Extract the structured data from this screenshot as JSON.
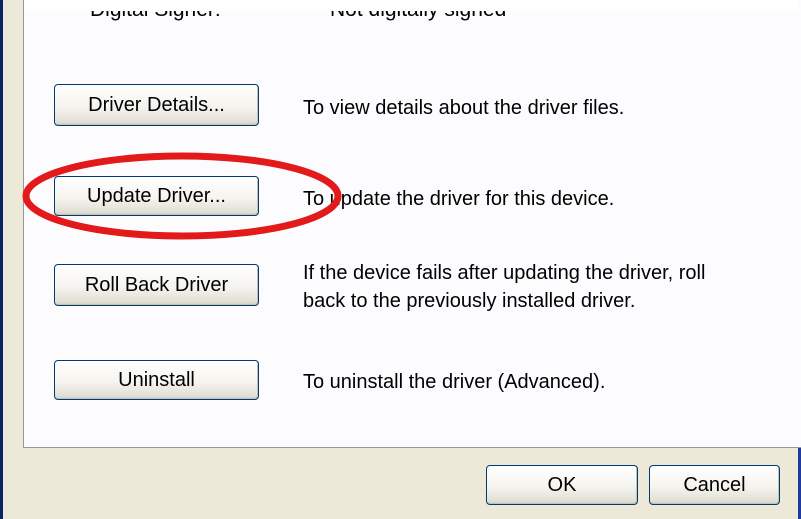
{
  "signer_row": {
    "label": "Digital Signer:",
    "value": "Not digitally signed"
  },
  "actions": [
    {
      "button": "Driver Details...",
      "description": "To view details about the driver files."
    },
    {
      "button": "Update Driver...",
      "description": "To update the driver for this device."
    },
    {
      "button": "Roll Back Driver",
      "description_line1": "If the device fails after updating the driver, roll",
      "description_line2": "back to the previously installed driver."
    },
    {
      "button": "Uninstall",
      "description": "To uninstall the driver (Advanced)."
    }
  ],
  "footer": {
    "ok_label": "OK",
    "cancel_label": "Cancel"
  },
  "annotation": {
    "highlight_color": "#e21a1a",
    "highlighted_item": "Update Driver..."
  }
}
